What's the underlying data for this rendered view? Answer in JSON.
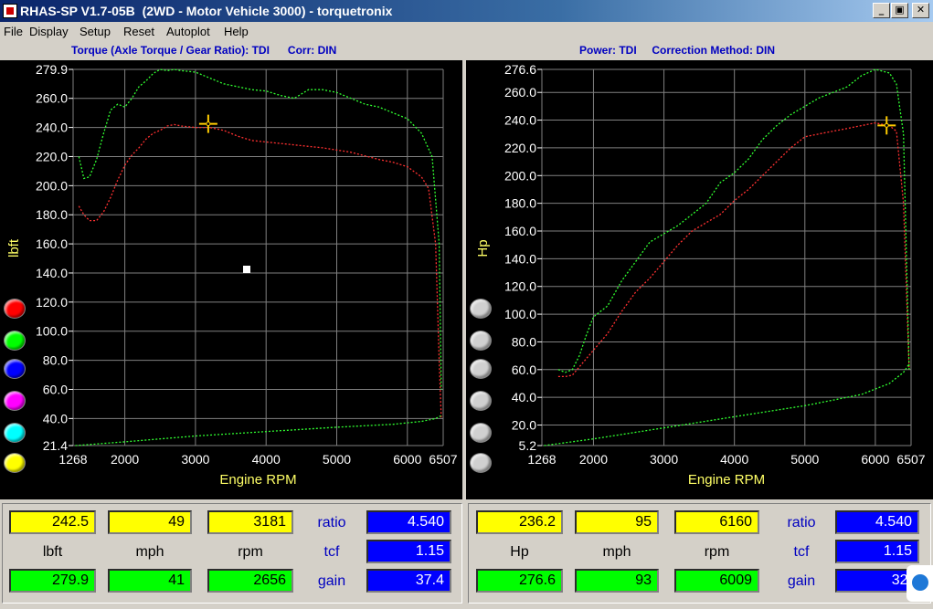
{
  "window": {
    "title": "RHAS-SP V1.7-05B  (2WD - Motor Vehicle 3000) - torquetronix",
    "buttons": {
      "minimize": "_",
      "maximize": "▣",
      "close": "✕"
    }
  },
  "menu": [
    "File",
    "Display",
    "Setup",
    "Reset",
    "Autoplot",
    "Help"
  ],
  "left": {
    "header": "Torque (Axle Torque / Gear Ratio): TDI      Corr: DIN",
    "readout": {
      "row1": [
        "242.5",
        "49",
        "3181"
      ],
      "units": [
        "lbft",
        "mph",
        "rpm"
      ],
      "row2": [
        "279.9",
        "41",
        "2656"
      ],
      "ratio_label": "ratio",
      "ratio": "4.540",
      "tcf_label": "tcf",
      "tcf": "1.15",
      "gain_label": "gain",
      "gain": "37.4"
    }
  },
  "right": {
    "header": "Power: TDI     Correction Method: DIN",
    "readout": {
      "row1": [
        "236.2",
        "95",
        "6160"
      ],
      "units": [
        "Hp",
        "mph",
        "rpm"
      ],
      "row2": [
        "276.6",
        "93",
        "6009"
      ],
      "ratio_label": "ratio",
      "ratio": "4.540",
      "tcf_label": "tcf",
      "tcf": "1.15",
      "gain_label": "gain",
      "gain": "32."
    }
  },
  "swatch_colors": [
    "#ff0000",
    "#00ff00",
    "#0000ff",
    "#ff00ff",
    "#00ffff",
    "#ffff00"
  ],
  "chart_data": [
    {
      "type": "line",
      "title": "Torque (Axle Torque / Gear Ratio): TDI",
      "xlabel": "Engine RPM",
      "ylabel": "lbft",
      "xlim": [
        1268,
        6507
      ],
      "ylim": [
        21.4,
        279.9
      ],
      "x_ticks": [
        "1268",
        "2000",
        "3000",
        "4000",
        "5000",
        "6000",
        "6507"
      ],
      "y_ticks": [
        "279.9",
        "260.0",
        "240.0",
        "220.0",
        "200.0",
        "180.0",
        "160.0",
        "140.0",
        "120.0",
        "100.0",
        "80.0",
        "60.0",
        "40.0",
        "21.4"
      ],
      "grid": true,
      "series": [
        {
          "color": "#ff3030",
          "x": [
            1350,
            1420,
            1500,
            1600,
            1700,
            1800,
            1900,
            2000,
            2100,
            2200,
            2300,
            2400,
            2500,
            2600,
            2700,
            2800,
            3000,
            3200,
            3400,
            3600,
            3800,
            4000,
            4400,
            4800,
            5200,
            5600,
            5800,
            6000,
            6200,
            6300,
            6400,
            6450,
            6480
          ],
          "y": [
            186,
            180,
            176,
            176,
            182,
            192,
            204,
            214,
            221,
            226,
            232,
            236,
            238,
            241,
            242,
            241,
            240,
            240,
            238,
            234,
            231,
            230,
            228,
            226,
            223,
            218,
            216,
            213,
            206,
            198,
            160,
            80,
            40
          ]
        },
        {
          "color": "#30ff30",
          "x": [
            1350,
            1420,
            1500,
            1600,
            1700,
            1800,
            1900,
            2000,
            2100,
            2200,
            2300,
            2400,
            2500,
            2600,
            2700,
            2800,
            3000,
            3200,
            3400,
            3600,
            3800,
            4000,
            4200,
            4400,
            4600,
            4800,
            5000,
            5200,
            5400,
            5600,
            5800,
            6000,
            6200,
            6350,
            6450,
            6480
          ],
          "y": [
            220,
            205,
            206,
            218,
            236,
            252,
            256,
            254,
            260,
            268,
            272,
            277,
            279.9,
            279,
            279.9,
            279,
            278,
            274,
            270,
            268,
            266,
            265,
            262,
            260,
            266,
            266,
            264,
            260,
            256,
            254,
            250,
            246,
            236,
            220,
            160,
            60
          ]
        },
        {
          "color": "#30ff30",
          "x": [
            1300,
            2000,
            3000,
            4000,
            5000,
            5800,
            6200,
            6400,
            6480
          ],
          "y": [
            21.4,
            24,
            28,
            31,
            34,
            36,
            38,
            40,
            42
          ]
        }
      ],
      "markers": [
        {
          "x": 3181,
          "y": 242.5
        }
      ]
    },
    {
      "type": "line",
      "title": "Power: TDI",
      "xlabel": "Engine RPM",
      "ylabel": "Hp",
      "xlim": [
        1268,
        6507
      ],
      "ylim": [
        5.2,
        276.6
      ],
      "x_ticks": [
        "1268",
        "2000",
        "3000",
        "4000",
        "5000",
        "6000",
        "6507"
      ],
      "y_ticks": [
        "276.6",
        "260.0",
        "240.0",
        "220.0",
        "200.0",
        "180.0",
        "160.0",
        "140.0",
        "120.0",
        "100.0",
        "80.0",
        "60.0",
        "40.0",
        "20.0",
        "5.2"
      ],
      "grid": true,
      "series": [
        {
          "color": "#ff3030",
          "x": [
            1500,
            1600,
            1700,
            1800,
            1900,
            2000,
            2200,
            2400,
            2600,
            2800,
            3000,
            3200,
            3400,
            3600,
            3800,
            4000,
            4200,
            4400,
            4600,
            4800,
            5000,
            5200,
            5400,
            5600,
            5800,
            6000,
            6100,
            6200,
            6300,
            6400,
            6480
          ],
          "y": [
            55,
            55,
            56,
            62,
            68,
            74,
            86,
            102,
            116,
            126,
            138,
            150,
            160,
            166,
            172,
            182,
            190,
            200,
            210,
            220,
            228,
            230,
            232,
            234,
            236,
            238,
            237,
            236,
            232,
            180,
            60
          ]
        },
        {
          "color": "#30ff30",
          "x": [
            1500,
            1600,
            1700,
            1800,
            1900,
            2000,
            2200,
            2400,
            2600,
            2800,
            3000,
            3200,
            3400,
            3600,
            3800,
            4000,
            4200,
            4400,
            4600,
            4800,
            5000,
            5200,
            5400,
            5600,
            5800,
            6000,
            6200,
            6300,
            6400,
            6480
          ],
          "y": [
            60,
            58,
            60,
            70,
            85,
            98,
            106,
            124,
            138,
            152,
            158,
            164,
            172,
            180,
            195,
            202,
            212,
            226,
            236,
            244,
            250,
            256,
            260,
            264,
            272,
            276.6,
            274,
            266,
            230,
            60
          ]
        },
        {
          "color": "#30ff30",
          "x": [
            1300,
            2000,
            3000,
            4000,
            5000,
            5800,
            6200,
            6400,
            6480
          ],
          "y": [
            5.2,
            10,
            18,
            26,
            34,
            42,
            50,
            58,
            64
          ]
        }
      ],
      "markers": [
        {
          "x": 6160,
          "y": 236.2
        }
      ]
    }
  ]
}
